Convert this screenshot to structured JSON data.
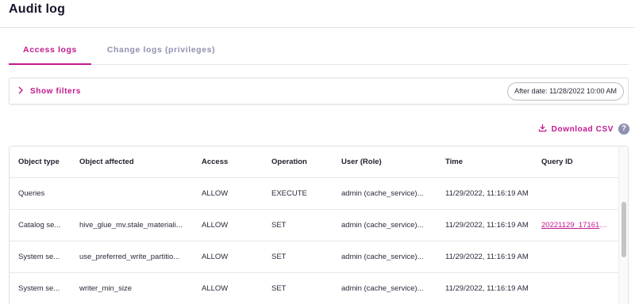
{
  "page": {
    "title": "Audit log"
  },
  "tabs": [
    {
      "label": "Access logs",
      "active": true
    },
    {
      "label": "Change logs (privileges)",
      "active": false
    }
  ],
  "filters": {
    "toggle_label": "Show filters",
    "chevron_icon": "chevron-right-icon",
    "date_chip": "After date: 11/28/2022 10:00 AM"
  },
  "actions": {
    "download_label": "Download CSV",
    "download_icon": "download-icon",
    "help_icon": "help-icon",
    "help_glyph": "?"
  },
  "colors": {
    "accent": "#c2188f",
    "muted": "#8f90b0",
    "border": "#e1e1e8"
  },
  "table": {
    "columns": [
      "Object type",
      "Object affected",
      "Access",
      "Operation",
      "User (Role)",
      "Time",
      "Query ID"
    ],
    "rows": [
      [
        "Queries",
        "",
        "ALLOW",
        "EXECUTE",
        "admin (cache_service)...",
        "11/29/2022, 11:16:19 AM",
        ""
      ],
      [
        "Catalog se...",
        "hive_glue_mv.stale_materiali...",
        "ALLOW",
        "SET",
        "admin (cache_service)...",
        "11/29/2022, 11:16:19 AM",
        "20221129_171619_..."
      ],
      [
        "System se...",
        "use_preferred_write_partitio...",
        "ALLOW",
        "SET",
        "admin (cache_service)...",
        "11/29/2022, 11:16:19 AM",
        ""
      ],
      [
        "System se...",
        "writer_min_size",
        "ALLOW",
        "SET",
        "admin (cache_service)...",
        "11/29/2022, 11:16:19 AM",
        ""
      ]
    ]
  }
}
